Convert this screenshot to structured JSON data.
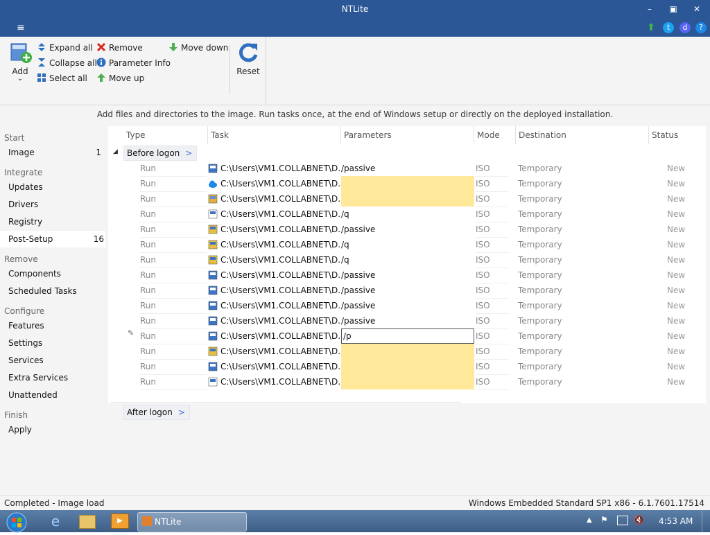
{
  "window": {
    "title": "NTLite"
  },
  "titlebar": {
    "minimize": "–",
    "restore": "▣",
    "close": "✕"
  },
  "menu": {
    "hamburger": "≡"
  },
  "ribbon": {
    "add_label": "Add",
    "add_arrow": "⌄",
    "expand_all": "Expand all",
    "collapse_all": "Collapse all",
    "select_all": "Select all",
    "remove": "Remove",
    "parameter_info": "Parameter Info",
    "move_up": "Move up",
    "move_down": "Move down",
    "reset": "Reset"
  },
  "hint": "Add files and directories to the image. Run tasks once, at the end of Windows setup or directly on the deployed installation.",
  "sidebar": {
    "start_header": "Start",
    "image": {
      "label": "Image",
      "count": "1"
    },
    "integrate_header": "Integrate",
    "updates": "Updates",
    "drivers": "Drivers",
    "registry": "Registry",
    "post_setup": {
      "label": "Post-Setup",
      "count": "16"
    },
    "remove_header": "Remove",
    "components": "Components",
    "scheduled_tasks": "Scheduled Tasks",
    "configure_header": "Configure",
    "features": "Features",
    "settings": "Settings",
    "services": "Services",
    "extra_services": "Extra Services",
    "unattended": "Unattended",
    "finish_header": "Finish",
    "apply": "Apply"
  },
  "grid": {
    "columns": [
      "Type",
      "Task",
      "Parameters",
      "Mode",
      "Destination",
      "Status"
    ],
    "group_before": "Before logon",
    "group_after": "After logon",
    "group_chevron": ">",
    "rows": [
      {
        "type": "Run",
        "task": "C:\\Users\\VM1.COLLABNET\\D...",
        "param": "/passive",
        "mode": "ISO",
        "dest": "Temporary",
        "status": "New",
        "icon": "installer-icon",
        "state": "normal"
      },
      {
        "type": "Run",
        "task": "C:\\Users\\VM1.COLLABNET\\D...",
        "param": "",
        "mode": "ISO",
        "dest": "Temporary",
        "status": "New",
        "icon": "cloud-icon",
        "state": "empty"
      },
      {
        "type": "Run",
        "task": "C:\\Users\\VM1.COLLABNET\\D...",
        "param": "",
        "mode": "ISO",
        "dest": "Temporary",
        "status": "New",
        "icon": "setup-icon",
        "state": "empty"
      },
      {
        "type": "Run",
        "task": "C:\\Users\\VM1.COLLABNET\\D...",
        "param": "/q",
        "mode": "ISO",
        "dest": "Temporary",
        "status": "New",
        "icon": "window-icon",
        "state": "normal"
      },
      {
        "type": "Run",
        "task": "C:\\Users\\VM1.COLLABNET\\D...",
        "param": "/passive",
        "mode": "ISO",
        "dest": "Temporary",
        "status": "New",
        "icon": "package-icon",
        "state": "normal"
      },
      {
        "type": "Run",
        "task": "C:\\Users\\VM1.COLLABNET\\D...",
        "param": "/q",
        "mode": "ISO",
        "dest": "Temporary",
        "status": "New",
        "icon": "package-icon",
        "state": "normal"
      },
      {
        "type": "Run",
        "task": "C:\\Users\\VM1.COLLABNET\\D...",
        "param": "/q",
        "mode": "ISO",
        "dest": "Temporary",
        "status": "New",
        "icon": "package-icon",
        "state": "normal"
      },
      {
        "type": "Run",
        "task": "C:\\Users\\VM1.COLLABNET\\D...",
        "param": "/passive",
        "mode": "ISO",
        "dest": "Temporary",
        "status": "New",
        "icon": "installer-icon",
        "state": "normal"
      },
      {
        "type": "Run",
        "task": "C:\\Users\\VM1.COLLABNET\\D...",
        "param": "/passive",
        "mode": "ISO",
        "dest": "Temporary",
        "status": "New",
        "icon": "installer-icon",
        "state": "normal"
      },
      {
        "type": "Run",
        "task": "C:\\Users\\VM1.COLLABNET\\D...",
        "param": "/passive",
        "mode": "ISO",
        "dest": "Temporary",
        "status": "New",
        "icon": "installer-icon",
        "state": "normal"
      },
      {
        "type": "Run",
        "task": "C:\\Users\\VM1.COLLABNET\\D...",
        "param": "/passive",
        "mode": "ISO",
        "dest": "Temporary",
        "status": "New",
        "icon": "installer-icon",
        "state": "normal"
      },
      {
        "type": "Run",
        "task": "C:\\Users\\VM1.COLLABNET\\D...",
        "param": "/p",
        "mode": "ISO",
        "dest": "Temporary",
        "status": "New",
        "icon": "installer-icon",
        "state": "editing"
      },
      {
        "type": "Run",
        "task": "C:\\Users\\VM1.COLLABNET\\D...",
        "param": "",
        "mode": "ISO",
        "dest": "Temporary",
        "status": "New",
        "icon": "package-icon",
        "state": "empty"
      },
      {
        "type": "Run",
        "task": "C:\\Users\\VM1.COLLABNET\\D...",
        "param": "",
        "mode": "ISO",
        "dest": "Temporary",
        "status": "New",
        "icon": "installer-icon",
        "state": "empty"
      },
      {
        "type": "Run",
        "task": "C:\\Users\\VM1.COLLABNET\\D...",
        "param": "",
        "mode": "ISO",
        "dest": "Temporary",
        "status": "New",
        "icon": "window-icon",
        "state": "empty"
      }
    ]
  },
  "statusbar": {
    "left": "Completed - Image load",
    "right": "Windows Embedded Standard SP1 x86 - 6.1.7601.17514"
  },
  "taskbar": {
    "app_label": "NTLite",
    "clock": "4:53 AM"
  },
  "colors": {
    "titlebar": "#2b5797",
    "empty_param": "#ffe89a",
    "accent_blue": "#3a6fd0"
  }
}
